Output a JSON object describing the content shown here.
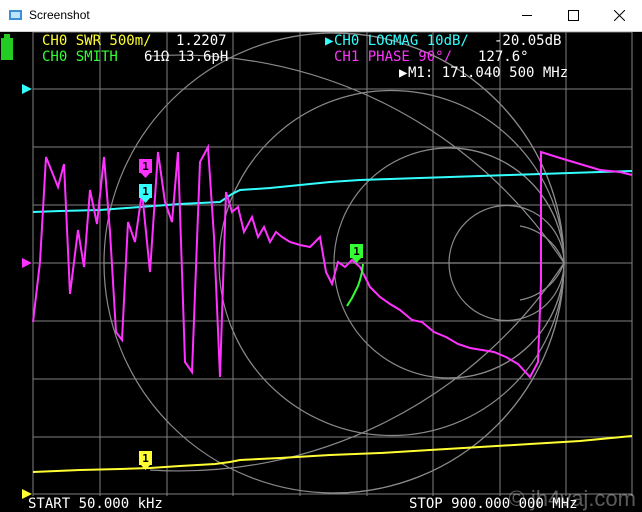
{
  "window": {
    "title": "Screenshot"
  },
  "header": {
    "trace0_swr_label": "CH0 SWR 500m/",
    "trace0_swr_value": "1.2207",
    "trace0_smith_label": "CH0 SMITH",
    "trace0_smith_value": "61Ω 13.6pH",
    "trace0_logmag_label": "CH0 LOGMAG 10dB/",
    "trace0_logmag_value": "-20.05dB",
    "trace1_phase_label": "CH1 PHASE 90°/",
    "trace1_phase_value": "127.6°",
    "marker_readout": "M1: 171.040 500 MHz"
  },
  "footer": {
    "start": "START 50.000 kHz",
    "stop": "STOP 900.000 000 MHz",
    "watermark": "© jh4vaj.com"
  },
  "markers": {
    "m1_label": "1"
  },
  "colors": {
    "swr": "#ffff33",
    "smith": "#33ff33",
    "logmag": "#33ffff",
    "phase": "#ff33ff",
    "grid": "#808080",
    "battery": "#22cc22"
  }
}
